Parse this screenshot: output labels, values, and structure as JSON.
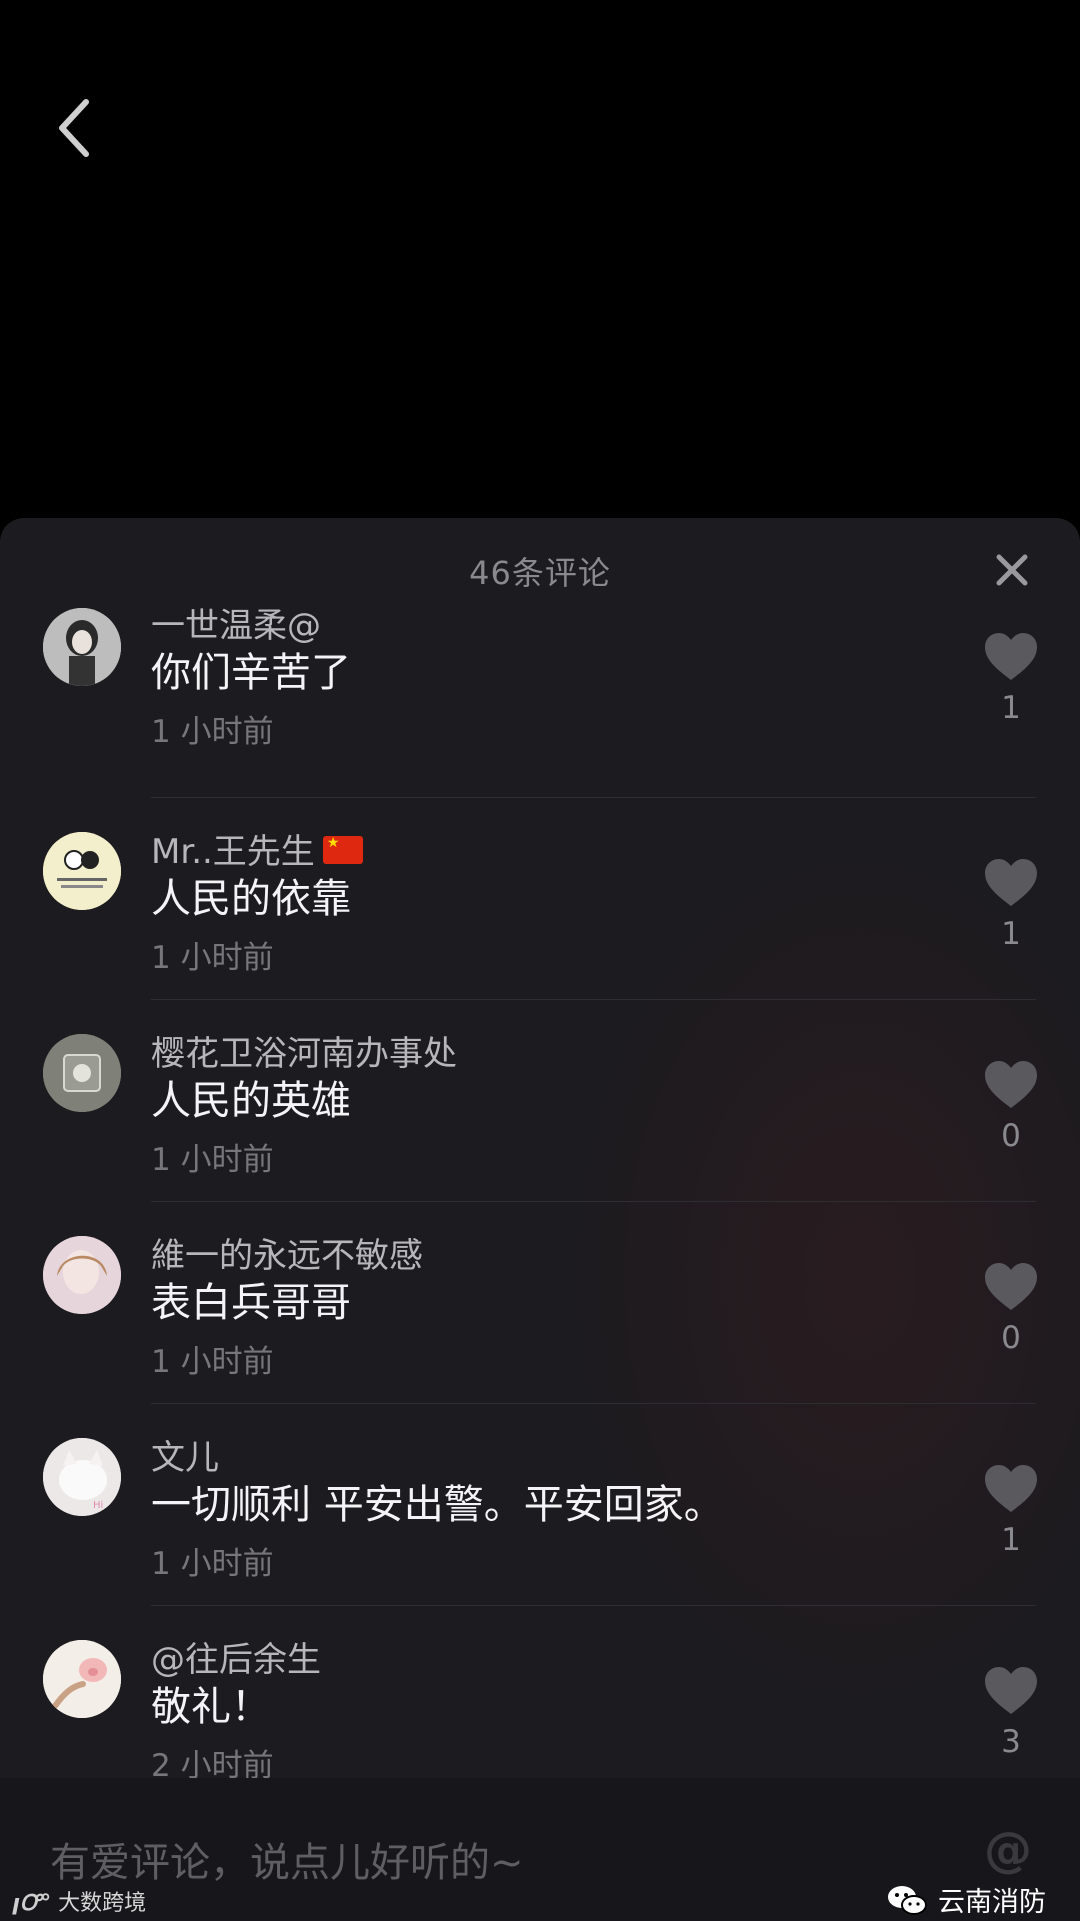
{
  "header": {
    "comment_count_title": "46条评论"
  },
  "comments": [
    {
      "username": "一世温柔@",
      "text": "你们辛苦了",
      "time": "1 小时前",
      "likes": "1",
      "avatar_color": "#d8d8d8"
    },
    {
      "username": "Mr..王先生",
      "text": "人民的依靠",
      "time": "1 小时前",
      "likes": "1",
      "avatar_color": "#f1ecc6"
    },
    {
      "username": "樱花卫浴河南办事处",
      "text": "人民的英雄",
      "time": "1 小时前",
      "likes": "0",
      "avatar_color": "#8a8a80"
    },
    {
      "username": "維一的永远不敏感",
      "text": "表白兵哥哥",
      "time": "1 小时前",
      "likes": "0",
      "avatar_color": "#c9a8b6"
    },
    {
      "username": "文儿",
      "text": "一切顺利  平安出警。平安回家。",
      "time": "1 小时前",
      "likes": "1",
      "avatar_color": "#e8e2e2"
    },
    {
      "username": "@往后余生",
      "text": "敬礼！",
      "time": "2 小时前",
      "likes": "3",
      "avatar_color": "#f2ece6"
    }
  ],
  "input": {
    "placeholder": "有爱评论，说点儿好听的~",
    "at_symbol": "@"
  },
  "watermarks": {
    "wechat_account": "云南消防",
    "corner_brand": "大数跨境"
  }
}
